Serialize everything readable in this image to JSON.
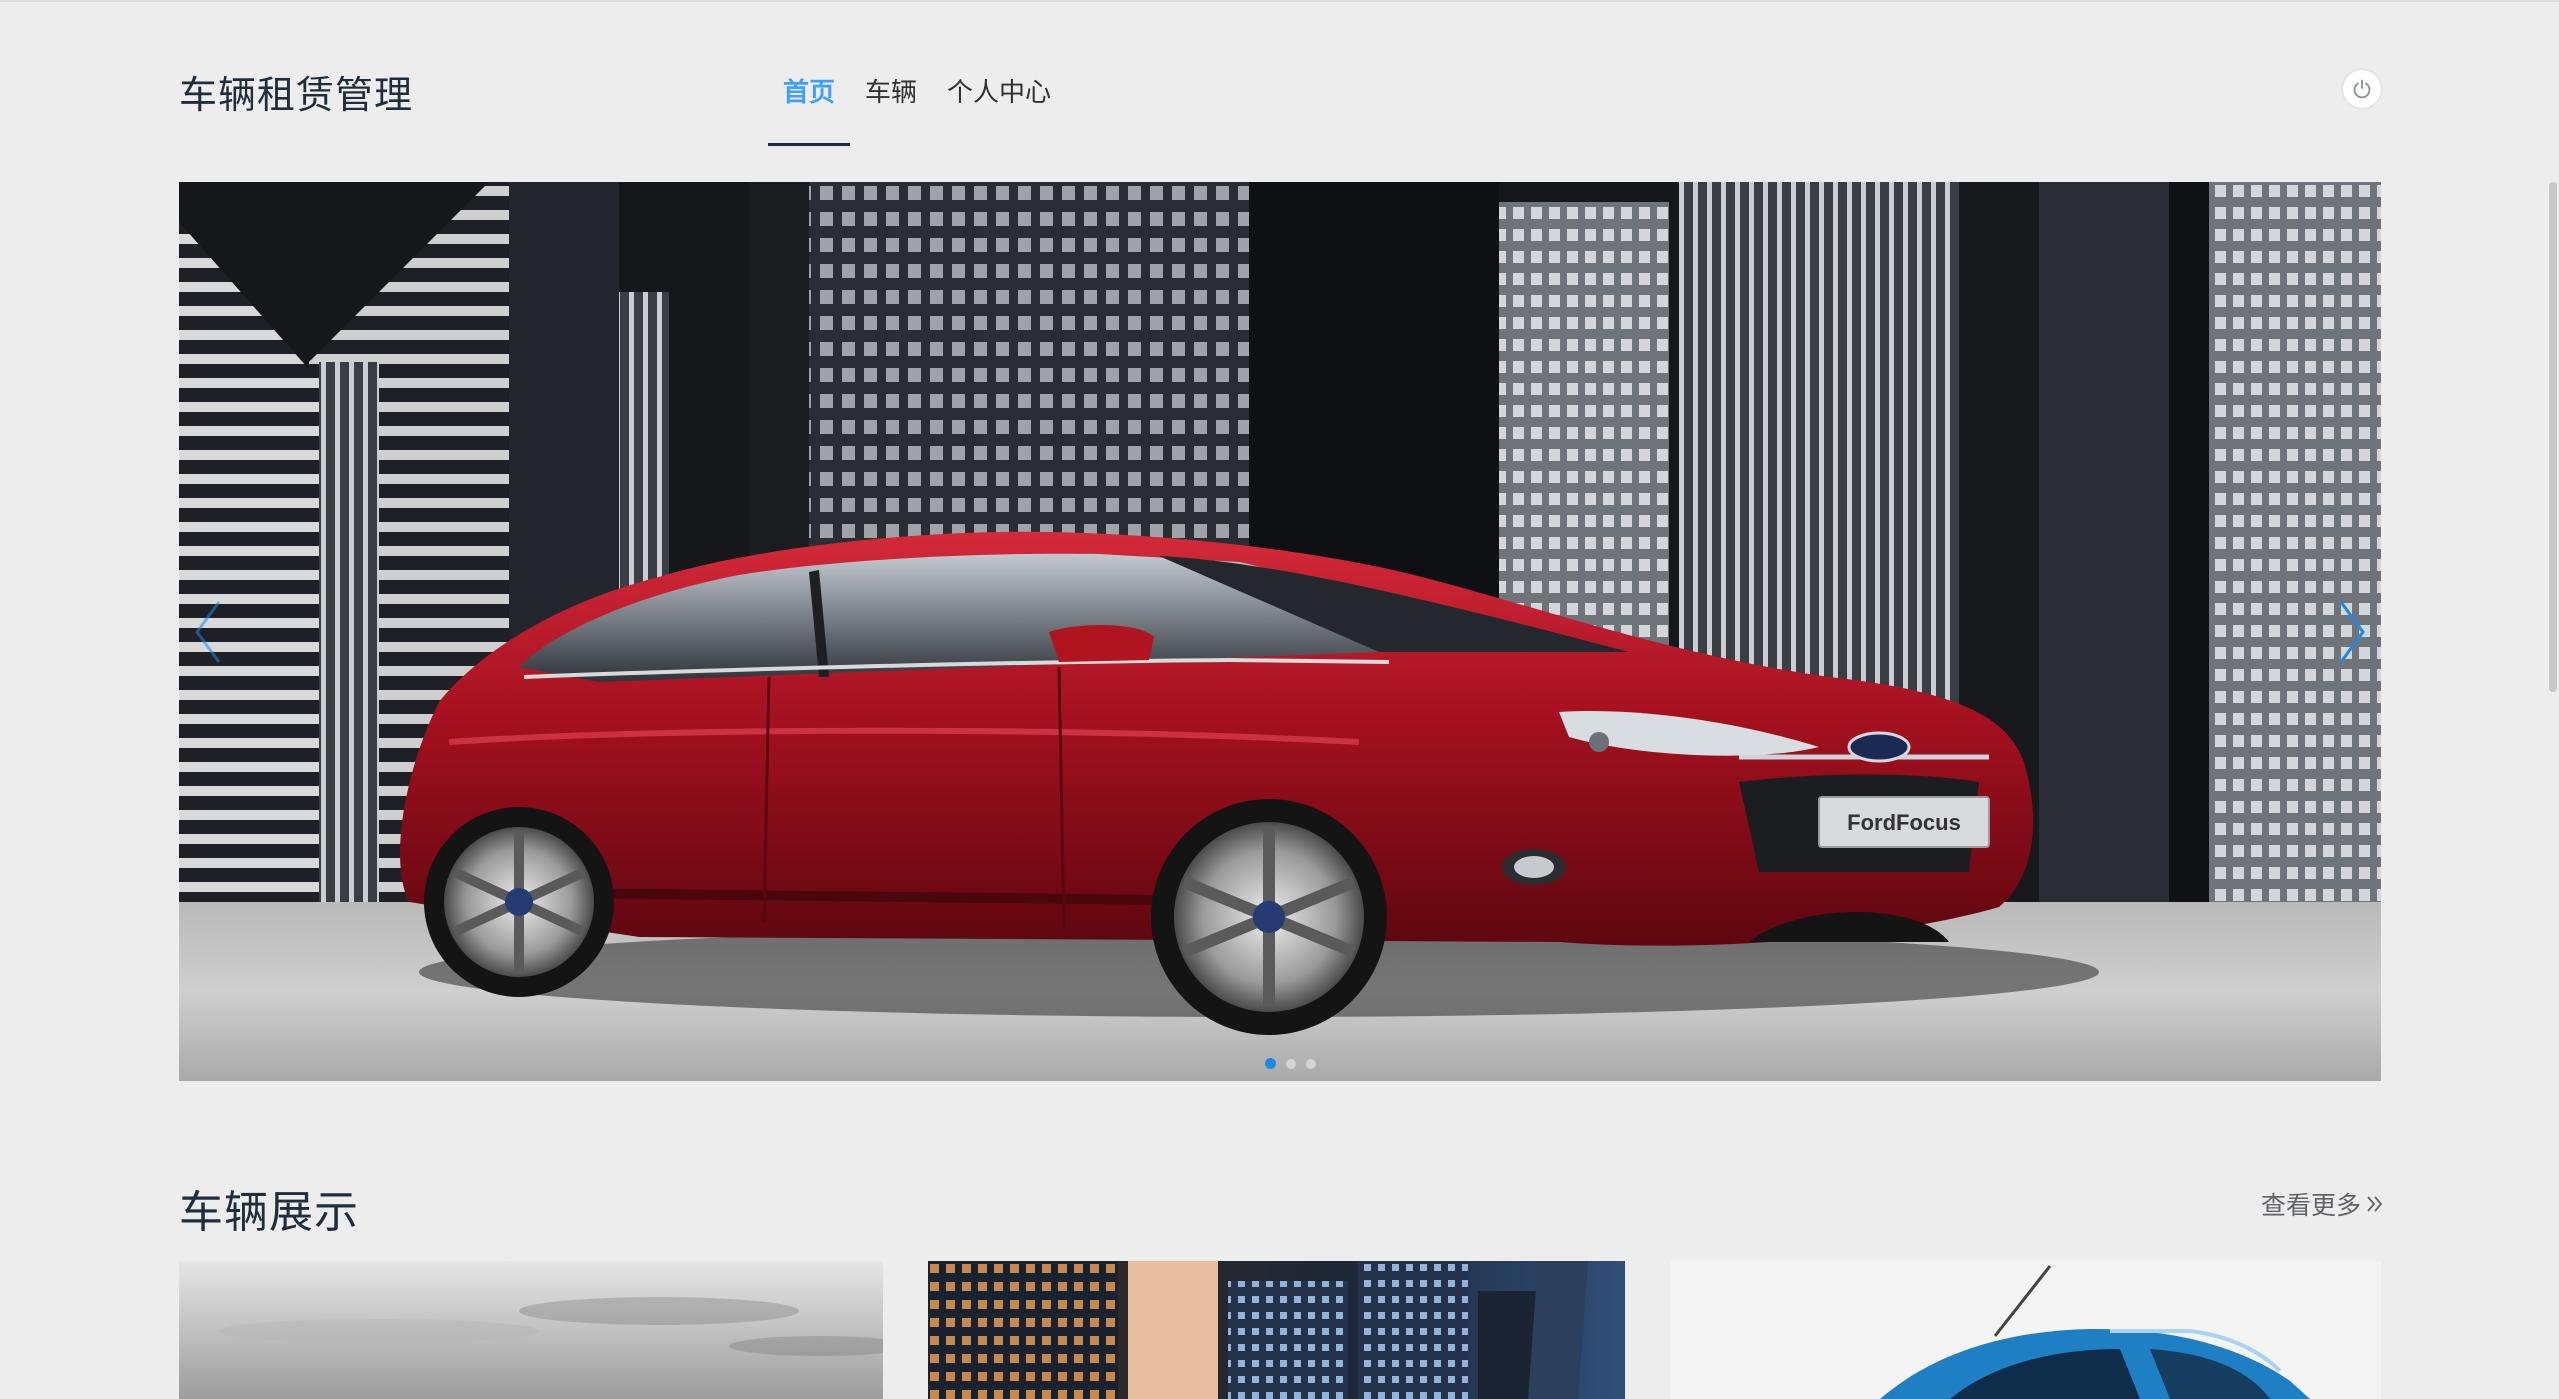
{
  "header": {
    "brand": "车辆租赁管理",
    "nav": [
      {
        "label": "首页",
        "active": true
      },
      {
        "label": "车辆",
        "active": false
      },
      {
        "label": "个人中心",
        "active": false
      }
    ],
    "power_icon": "power-icon"
  },
  "carousel": {
    "active_index": 0,
    "slide_count": 3,
    "plate_text": "FordFocus",
    "colors": {
      "car_body": "#a5101f",
      "arrow": "#1e88e5"
    },
    "icons": {
      "prev": "chevron-left-icon",
      "next": "chevron-right-icon"
    }
  },
  "section": {
    "title": "车辆展示",
    "more_label": "查看更多",
    "more_icon": "double-chevron-right-icon"
  },
  "cards": [
    {
      "image": "car-on-cloudy-sky"
    },
    {
      "image": "car-in-city-at-dusk"
    },
    {
      "image": "blue-car-on-white"
    }
  ],
  "colors": {
    "accent": "#409eff",
    "brand_text": "#1f2d3d",
    "background": "#ededed"
  }
}
